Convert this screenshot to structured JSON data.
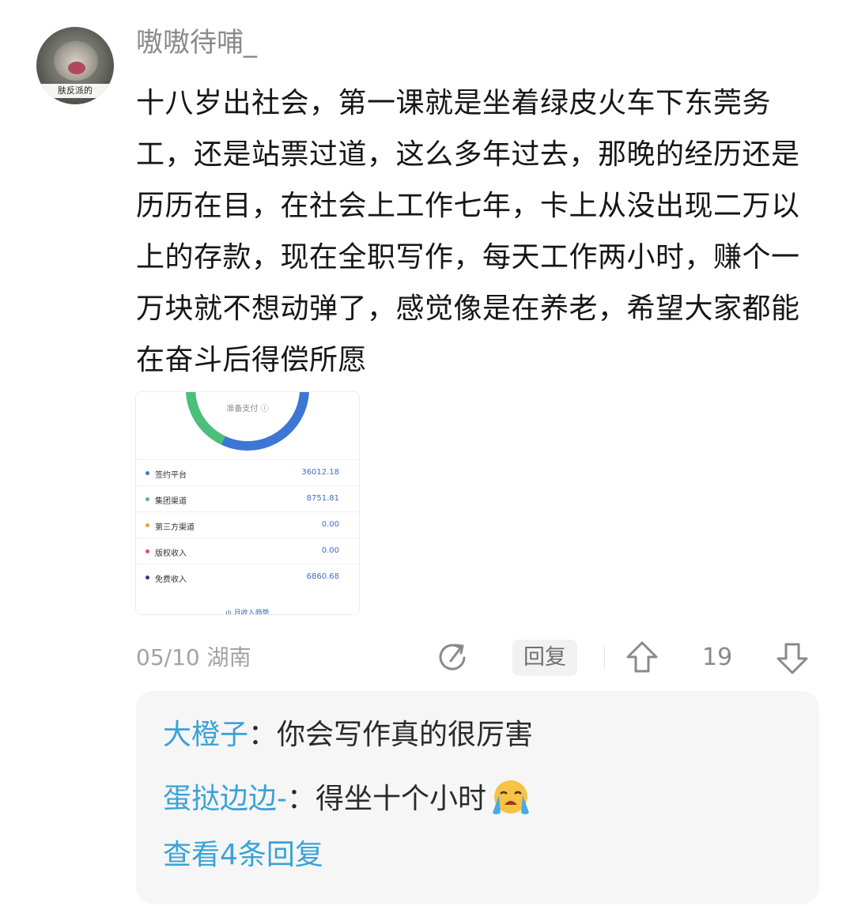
{
  "comment": {
    "username": "嗷嗷待哺_",
    "avatar_tag": "肤反派的",
    "content": "十八岁出社会，第一课就是坐着绿皮火车下东莞务工，还是站票过道，这么多年过去，那晚的经历还是历历在目，在社会上工作七年，卡上从没出现二万以上的存款，现在全职写作，每天工作两小时，赚个一万块就不想动弹了，感觉像是在养老，希望大家都能在奋斗后得偿所愿",
    "date": "05/10",
    "location": "湖南",
    "reply_label": "回复",
    "like_count": "19"
  },
  "screenshot": {
    "ring_label": "准备支付 ⓘ",
    "rows": [
      {
        "label": "签约平台",
        "value": "36012.18",
        "color": "#3d76d4"
      },
      {
        "label": "集团渠道",
        "value": "8751.81",
        "color": "#4cbf7a"
      },
      {
        "label": "第三方渠道",
        "value": "0.00",
        "color": "#f0a23c"
      },
      {
        "label": "版权收入",
        "value": "0.00",
        "color": "#e0506a"
      },
      {
        "label": "免费收入",
        "value": "6860.68",
        "color": "#2c3a7a"
      }
    ],
    "footer": "ılı 月收入趋势"
  },
  "replies": [
    {
      "name": "大橙子",
      "sep": "：",
      "text": "你会写作真的很厉害"
    },
    {
      "name": "蛋挞边边-",
      "sep": "：",
      "text": "得坐十个小时"
    }
  ],
  "view_more": "查看4条回复"
}
